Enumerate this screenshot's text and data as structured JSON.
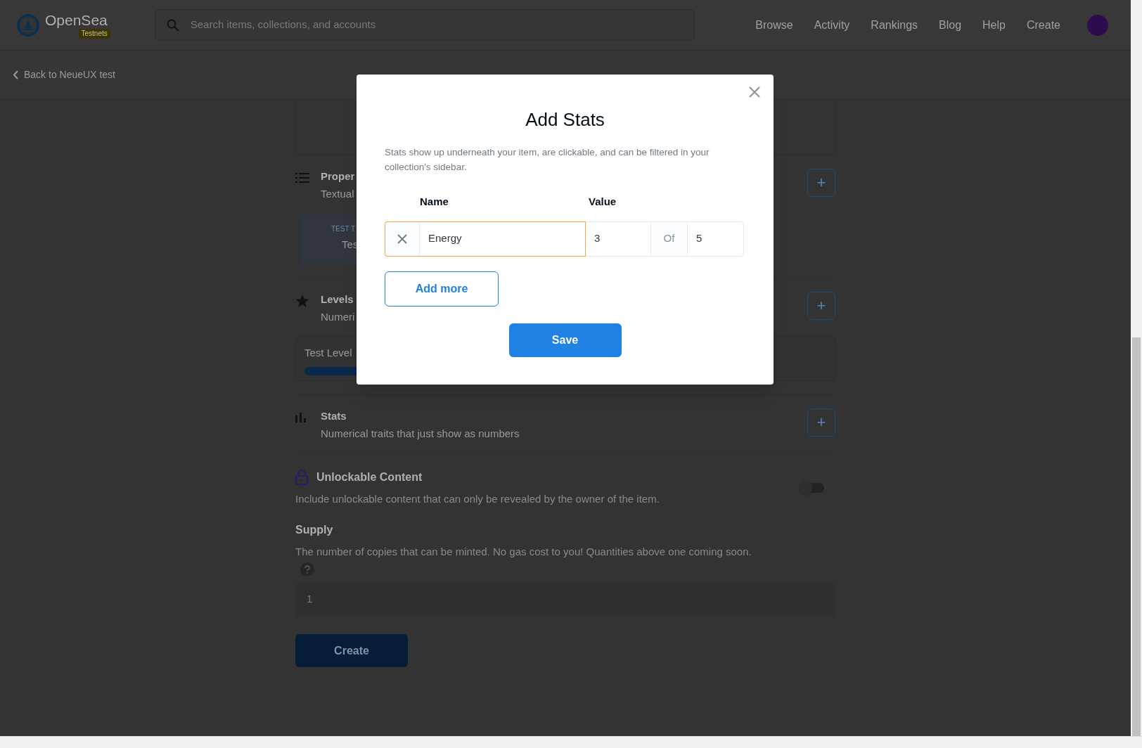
{
  "header": {
    "logo_text": "OpenSea",
    "badge": "Testnets",
    "search": {
      "placeholder": "Search items, collections, and accounts"
    },
    "nav": [
      "Browse",
      "Activity",
      "Rankings",
      "Blog",
      "Help",
      "Create"
    ]
  },
  "back_link": "Back to NeueUX test",
  "sections": [
    {
      "kind": "properties",
      "title": "Proper",
      "subtitle": "Textual",
      "add_label": "+",
      "card": {
        "label": "TEST T",
        "value": "Tes"
      }
    },
    {
      "kind": "levels",
      "title": "Levels",
      "subtitle": "Numeri",
      "add_label": "+",
      "card": {
        "label": "Test Level"
      }
    },
    {
      "kind": "stats",
      "title": "Stats",
      "subtitle": "Numerical traits that just show as numbers",
      "add_label": "+"
    }
  ],
  "unlockable": {
    "title": "Unlockable Content",
    "description": "Include unlockable content that can only be revealed by the owner of the item.",
    "on": false
  },
  "supply": {
    "title": "Supply",
    "description": "The number of copies that can be minted. No gas cost to you! Quantities above one coming soon.",
    "placeholder": "1"
  },
  "create_button": "Create",
  "modal": {
    "title": "Add Stats",
    "description": "Stats show up underneath your item, are clickable, and can be filtered in your collection's sidebar.",
    "columns": [
      "Name",
      "Value"
    ],
    "rows": [
      {
        "name": "Energy",
        "value": "3",
        "of": "Of",
        "max": "5",
        "focused": true
      }
    ],
    "add_more": "Add more",
    "save": "Save"
  }
}
